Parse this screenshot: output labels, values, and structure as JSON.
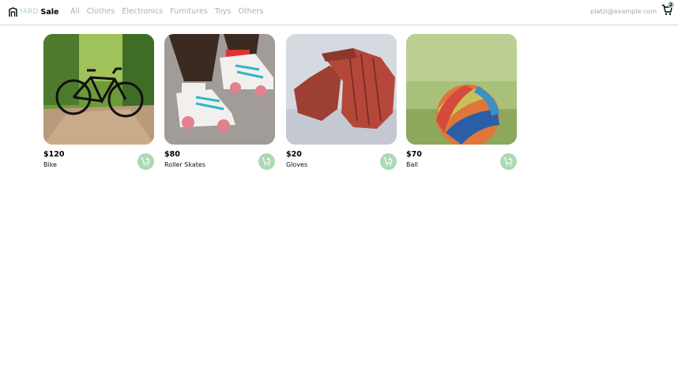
{
  "brand": {
    "yard": "YARD",
    "sale": "Sale"
  },
  "nav": {
    "items": [
      "All",
      "Clothes",
      "Electronics",
      "Furnitures",
      "Toys",
      "Others"
    ]
  },
  "user": {
    "email": "platzi@example.com"
  },
  "cart": {
    "count": "2",
    "icon": "shopping-cart-icon"
  },
  "colors": {
    "accent": "#ACD9B2",
    "muted_text": "#B0B0B0",
    "border": "#D7D7D7"
  },
  "products": [
    {
      "price": "$120",
      "name": "Bike"
    },
    {
      "price": "$80",
      "name": "Roller Skates"
    },
    {
      "price": "$20",
      "name": "Gloves"
    },
    {
      "price": "$70",
      "name": "Ball"
    }
  ]
}
